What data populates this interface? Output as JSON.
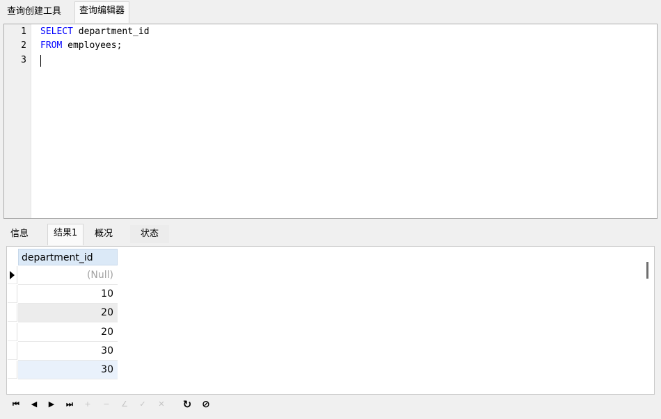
{
  "top_tabs": [
    {
      "label": "查询创建工具"
    },
    {
      "label": "查询编辑器"
    }
  ],
  "editor": {
    "line_numbers": [
      "1",
      "2",
      "3"
    ],
    "lines": [
      {
        "keyword": "SELECT",
        "rest": " department_id"
      },
      {
        "keyword": "FROM",
        "rest": " employees;"
      },
      {
        "keyword": "",
        "rest": ""
      }
    ]
  },
  "result_tabs": [
    {
      "label": "信息"
    },
    {
      "label": "结果1"
    },
    {
      "label": "概况"
    },
    {
      "label": "状态"
    }
  ],
  "grid": {
    "column": "department_id",
    "rows": [
      "(Null)",
      "10",
      "20",
      "20",
      "30",
      "30"
    ]
  },
  "navbar": {
    "buttons": [
      {
        "icon": "first-record-icon",
        "glyph": "⏮"
      },
      {
        "icon": "prev-record-icon",
        "glyph": "◀"
      },
      {
        "icon": "next-record-icon",
        "glyph": "▶"
      },
      {
        "icon": "last-record-icon",
        "glyph": "⏭"
      },
      {
        "icon": "add-record-icon",
        "glyph": "+"
      },
      {
        "icon": "delete-record-icon",
        "glyph": "−"
      },
      {
        "icon": "edit-record-icon",
        "glyph": "∠"
      },
      {
        "icon": "apply-icon",
        "glyph": "✓"
      },
      {
        "icon": "cancel-icon",
        "glyph": "✕"
      },
      {
        "icon": "refresh-icon",
        "glyph": "↻"
      },
      {
        "icon": "stop-icon",
        "glyph": "⊘"
      }
    ]
  }
}
